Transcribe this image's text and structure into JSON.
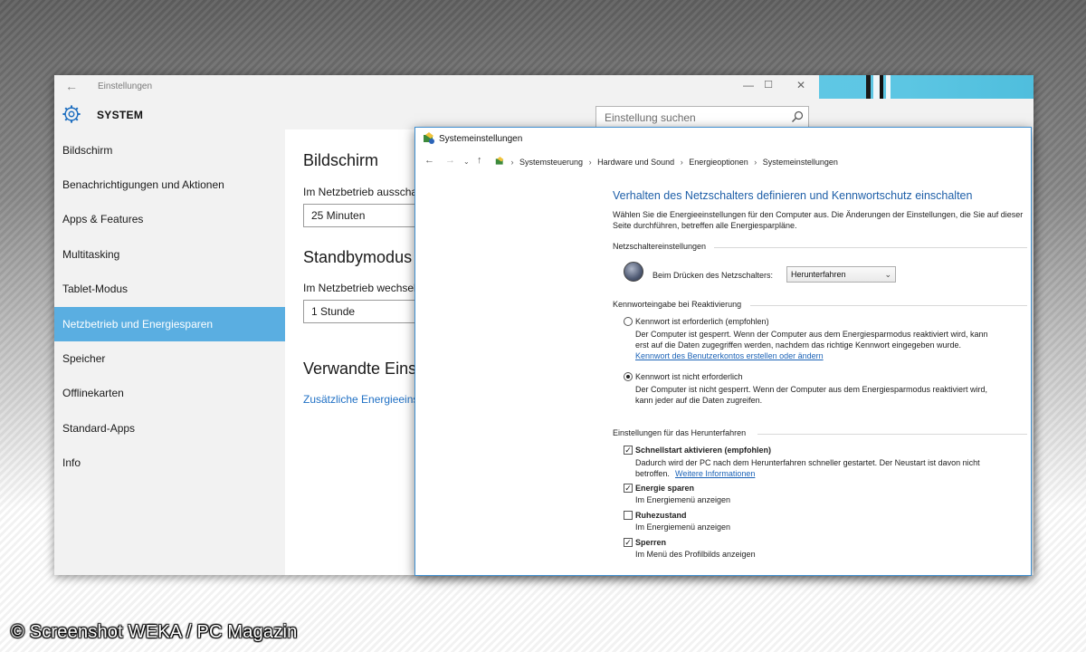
{
  "settings": {
    "window_title": "Einstellungen",
    "section_title": "SYSTEM",
    "search_placeholder": "Einstellung suchen",
    "nav_items": [
      {
        "label": "Bildschirm",
        "active": false
      },
      {
        "label": "Benachrichtigungen und Aktionen",
        "active": false
      },
      {
        "label": "Apps & Features",
        "active": false
      },
      {
        "label": "Multitasking",
        "active": false
      },
      {
        "label": "Tablet-Modus",
        "active": false
      },
      {
        "label": "Netzbetrieb und Energiesparen",
        "active": true
      },
      {
        "label": "Speicher",
        "active": false
      },
      {
        "label": "Offlinekarten",
        "active": false
      },
      {
        "label": "Standard-Apps",
        "active": false
      },
      {
        "label": "Info",
        "active": false
      }
    ],
    "content": {
      "screen_heading": "Bildschirm",
      "screen_label": "Im Netzbetrieb ausscha",
      "screen_value": "25 Minuten",
      "standby_heading": "Standbymodus",
      "standby_label": "Im Netzbetrieb wechsel",
      "standby_value": "1 Stunde",
      "related_heading": "Verwandte Eins",
      "related_link": "Zusätzliche Energieeinst"
    },
    "accent_color": "#5aaee1"
  },
  "control_panel": {
    "window_title": "Systemeinstellungen",
    "breadcrumb": [
      "Systemsteuerung",
      "Hardware und Sound",
      "Energieoptionen",
      "Systemeinstellungen"
    ],
    "heading": "Verhalten des Netzschalters definieren und Kennwortschutz einschalten",
    "subtext": "Wählen Sie die Energieeinstellungen für den Computer aus. Die Änderungen der Einstellungen, die Sie auf dieser Seite durchführen, betreffen alle Energiesparpläne.",
    "power_section": "Netzschaltereinstellungen",
    "power_label": "Beim Drücken des Netzschalters:",
    "power_value": "Herunterfahren",
    "password_section": "Kennworteingabe bei Reaktivierung",
    "password_required_label": "Kennwort ist erforderlich (empfohlen)",
    "password_required_desc1": "Der Computer ist gesperrt. Wenn der Computer aus dem Energiesparmodus reaktiviert wird, kann",
    "password_required_desc2": "erst auf die Daten zugegriffen werden, nachdem das richtige Kennwort eingegeben wurde.",
    "password_link": "Kennwort des Benutzerkontos erstellen oder ändern",
    "password_not_required_label": "Kennwort ist nicht erforderlich",
    "password_not_required_desc1": "Der Computer ist nicht gesperrt. Wenn der Computer aus dem Energiesparmodus reaktiviert wird,",
    "password_not_required_desc2": "kann jeder auf die Daten zugreifen.",
    "password_selected": "not_required",
    "shutdown_section": "Einstellungen für das Herunterfahren",
    "shutdown_options": [
      {
        "label": "Schnellstart aktivieren (empfohlen)",
        "checked": true,
        "desc": "Dadurch wird der PC nach dem Herunterfahren schneller gestartet. Der Neustart ist davon nicht",
        "desc2": "betroffen.",
        "link": "Weitere Informationen"
      },
      {
        "label": "Energie sparen",
        "checked": true,
        "desc": "Im Energiemenü anzeigen"
      },
      {
        "label": "Ruhezustand",
        "checked": false,
        "desc": "Im Energiemenü anzeigen"
      },
      {
        "label": "Sperren",
        "checked": true,
        "desc": "Im Menü des Profilbilds anzeigen"
      }
    ],
    "heading_color": "#1e5fa8"
  },
  "copyright": "© Screenshot WEKA / PC Magazin"
}
